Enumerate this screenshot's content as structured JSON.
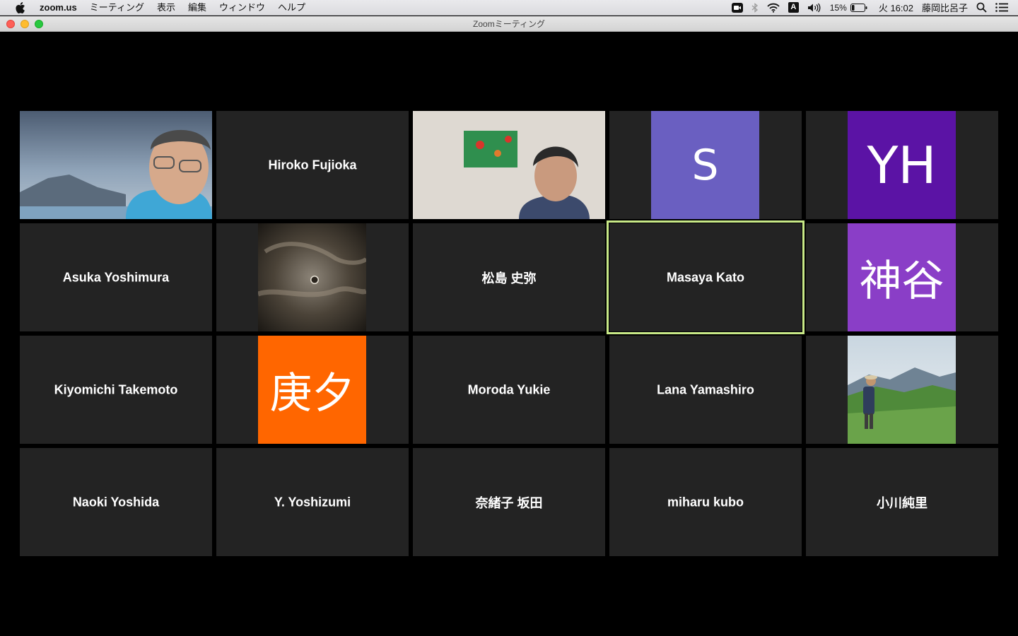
{
  "menubar": {
    "apple_icon": "apple-icon",
    "app_name": "zoom.us",
    "items": [
      "ミーティング",
      "表示",
      "編集",
      "ウィンドウ",
      "ヘルプ"
    ],
    "input_source": "A",
    "battery": "15%",
    "clock": "火 16:02",
    "user": "藤岡比呂子"
  },
  "window": {
    "title": "Zoomミーティング"
  },
  "colors": {
    "active_speaker": "#c8e987",
    "tile_bg": "#232323"
  },
  "participants": [
    {
      "name": "",
      "video": "man-with-glasses-sky"
    },
    {
      "name": "Hiroko Fujioka"
    },
    {
      "name": "",
      "video": "man-in-room-with-poster"
    },
    {
      "name": "",
      "initials": "S",
      "color": "#6a5fc1"
    },
    {
      "name": "",
      "initials": "YH",
      "color": "#5b13a5"
    },
    {
      "name": "Asuka Yoshimura"
    },
    {
      "name": "",
      "photo": "moon-clouds"
    },
    {
      "name": "松島 史弥"
    },
    {
      "name": "Masaya Kato",
      "active": true
    },
    {
      "name": "",
      "initials": "神谷",
      "color": "#8a3ec7"
    },
    {
      "name": "Kiyomichi Takemoto"
    },
    {
      "name": "",
      "initials": "庚夕",
      "color": "#ff6600"
    },
    {
      "name": "Moroda Yukie"
    },
    {
      "name": "Lana Yamashiro"
    },
    {
      "name": "",
      "photo": "hiker-mountain"
    },
    {
      "name": "Naoki Yoshida"
    },
    {
      "name": "Y. Yoshizumi"
    },
    {
      "name": "奈緒子 坂田"
    },
    {
      "name": "miharu kubo"
    },
    {
      "name": "小川純里"
    }
  ]
}
